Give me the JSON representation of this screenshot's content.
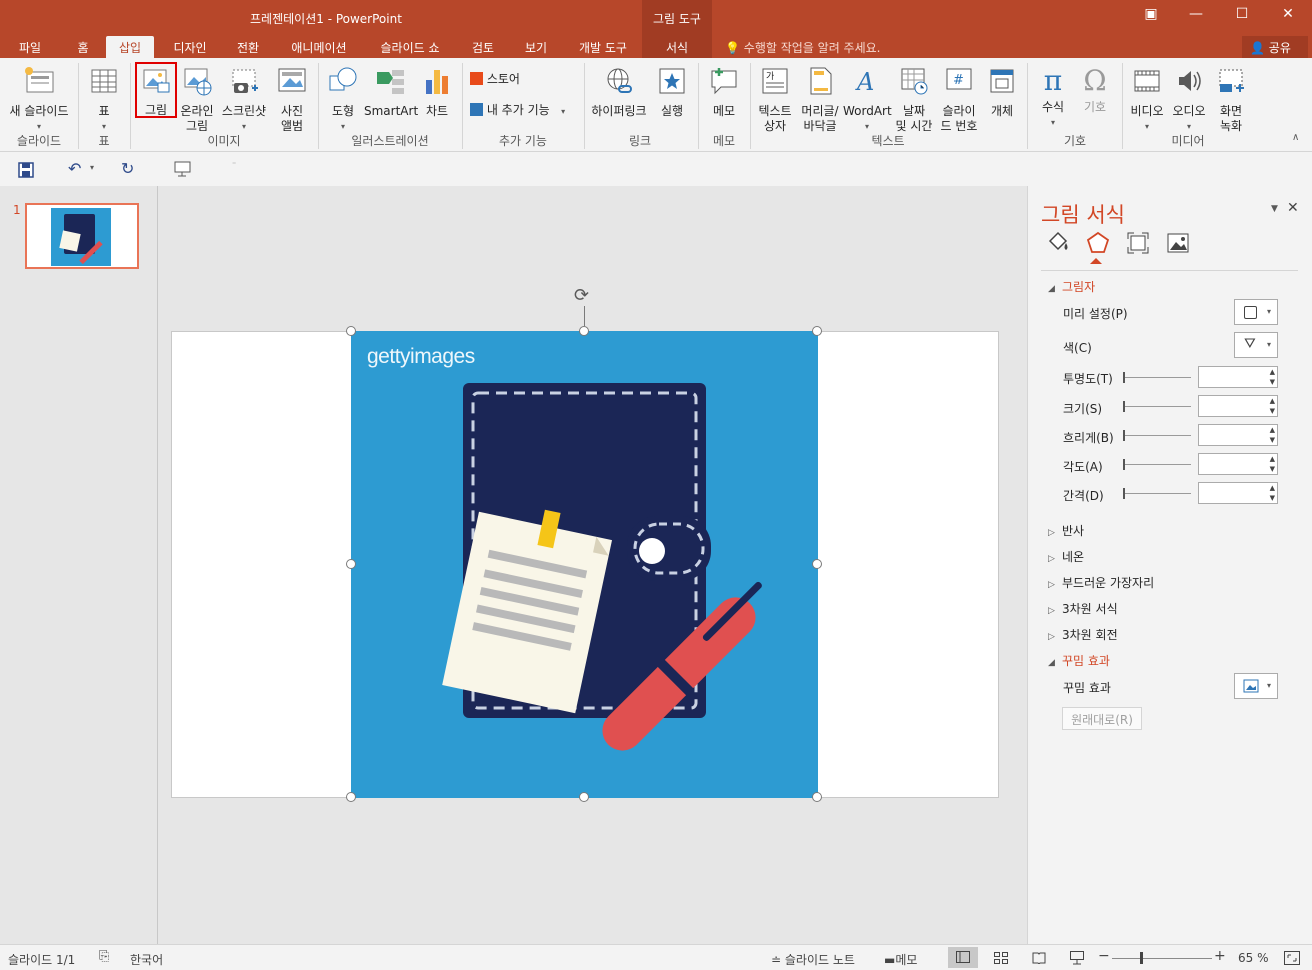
{
  "window": {
    "title": "프레젠테이션1 - PowerPoint",
    "context_tab_group": "그림 도구",
    "buttons": [
      "restore-ribbon",
      "minimize",
      "maximize",
      "close"
    ]
  },
  "tabs": [
    "파일",
    "홈",
    "삽입",
    "디자인",
    "전환",
    "애니메이션",
    "슬라이드 쇼",
    "검토",
    "보기",
    "개발 도구",
    "서식"
  ],
  "active_tab": "삽입",
  "tell_me": "수행할 작업을 알려 주세요.",
  "share": "공유",
  "ribbon": {
    "slides": {
      "new_slide_l1": "새 슬라이드",
      "group": "슬라이드"
    },
    "tables": {
      "table": "표",
      "group": "표"
    },
    "images": {
      "picture": "그림",
      "online_l1": "온라인",
      "online_l2": "그림",
      "screenshot": "스크린샷",
      "album_l1": "사진",
      "album_l2": "앨범",
      "group": "이미지"
    },
    "illustrations": {
      "shapes": "도형",
      "smartart": "SmartArt",
      "chart": "차트",
      "group": "일러스트레이션"
    },
    "addins": {
      "store": "스토어",
      "my_addins": "내 추가 기능",
      "group": "추가 기능"
    },
    "links": {
      "hyperlink": "하이퍼링크",
      "action": "실행",
      "group": "링크"
    },
    "comments": {
      "comment": "메모",
      "group": "메모"
    },
    "text": {
      "textbox_l1": "텍스트",
      "textbox_l2": "상자",
      "header_l1": "머리글/",
      "header_l2": "바닥글",
      "wordart": "WordArt",
      "date_l1": "날짜",
      "date_l2": "및 시간",
      "slideno_l1": "슬라이",
      "slideno_l2": "드 번호",
      "object": "개체",
      "group": "텍스트"
    },
    "symbols": {
      "equation": "수식",
      "symbol": "기호",
      "group": "기호"
    },
    "media": {
      "video": "비디오",
      "audio": "오디오",
      "rec_l1": "화면",
      "rec_l2": "녹화",
      "group": "미디어"
    }
  },
  "thumbnail": {
    "number": "1"
  },
  "picture": {
    "watermark": "gettyimages"
  },
  "format_pane": {
    "title": "그림 서식",
    "shadow_section": "그림자",
    "preset": "미리 설정(P)",
    "color": "색(C)",
    "transparency": "투명도(T)",
    "size": "크기(S)",
    "blur": "흐리게(B)",
    "angle": "각도(A)",
    "distance": "간격(D)",
    "sections": [
      "반사",
      "네온",
      "부드러운 가장자리",
      "3차원 서식",
      "3차원 회전"
    ],
    "artistic_section": "꾸밈 효과",
    "artistic_label": "꾸밈 효과",
    "reset": "원래대로(R)"
  },
  "status": {
    "slide": "슬라이드 1/1",
    "language": "한국어",
    "notes": "슬라이드 노트",
    "comments": "메모",
    "zoom": "65 %"
  }
}
